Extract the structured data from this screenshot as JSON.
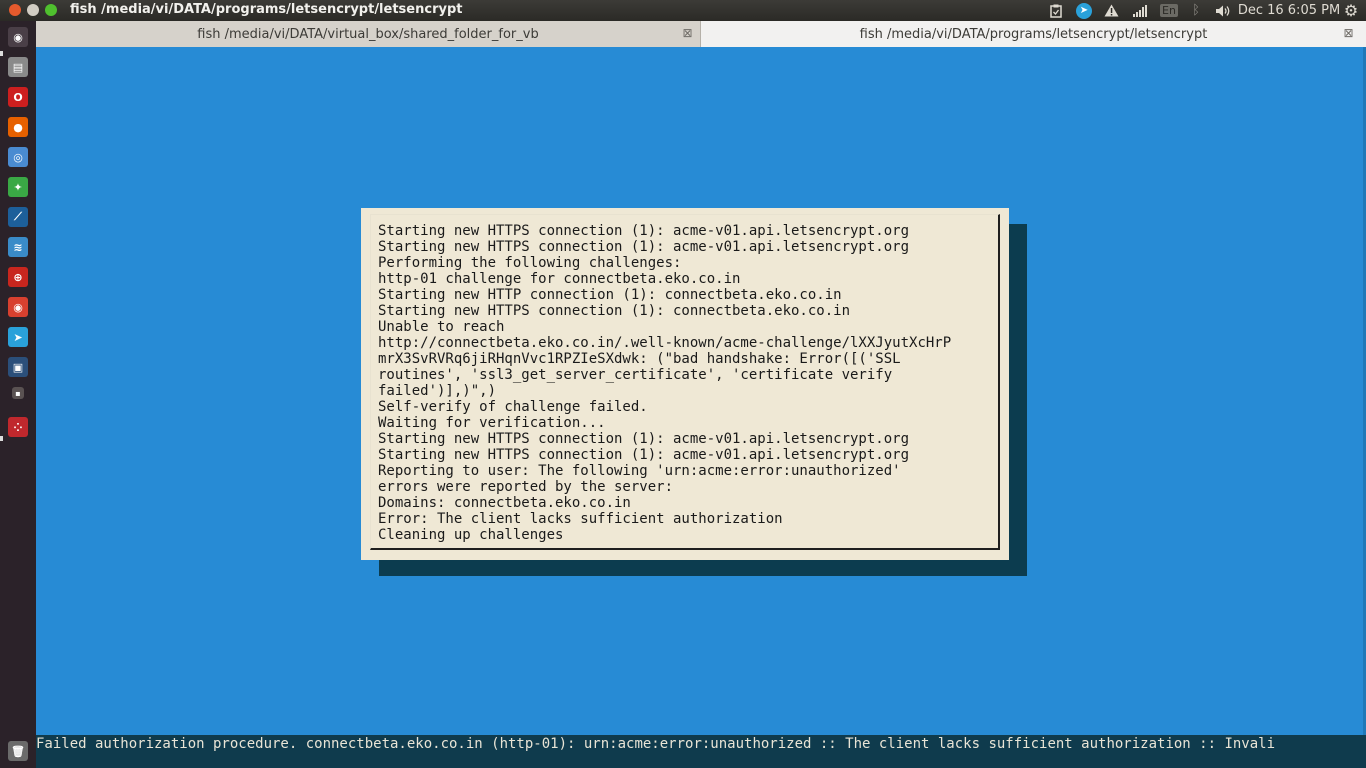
{
  "window": {
    "title": "fish  /media/vi/DATA/programs/letsencrypt/letsencrypt"
  },
  "tray": {
    "language": "En",
    "clock": "Dec 16  6:05 PM",
    "icons": [
      "clipboard-icon",
      "telegram-icon",
      "warning-icon",
      "network-signal-icon",
      "bluetooth-icon",
      "volume-icon",
      "gear-icon"
    ]
  },
  "launcher": {
    "items": [
      {
        "name": "dash-home",
        "color": "#4a3f47",
        "glyph": "◉"
      },
      {
        "name": "files",
        "color": "#8a8a8a",
        "glyph": "▤"
      },
      {
        "name": "opera",
        "color": "#cc1f1f",
        "glyph": "O"
      },
      {
        "name": "firefox",
        "color": "#e66000",
        "glyph": "●"
      },
      {
        "name": "chromium",
        "color": "#4a8bd1",
        "glyph": "◎"
      },
      {
        "name": "app-green",
        "color": "#3aa845",
        "glyph": "✦"
      },
      {
        "name": "app-wireshark",
        "color": "#1d5f9a",
        "glyph": "⟋"
      },
      {
        "name": "system-monitor",
        "color": "#3a8bc8",
        "glyph": "≋"
      },
      {
        "name": "ssl-vpn",
        "color": "#c8261e",
        "glyph": "⊕"
      },
      {
        "name": "chrome",
        "color": "#d8402f",
        "glyph": "◉"
      },
      {
        "name": "telegram",
        "color": "#2aa1da",
        "glyph": "➤"
      },
      {
        "name": "virtualbox-terminal",
        "color": "#2b4f7a",
        "glyph": "▣"
      },
      {
        "name": "small-app",
        "color": "#5a5252",
        "glyph": "▪"
      },
      {
        "name": "app-red-grid",
        "color": "#c0282d",
        "glyph": "⁘"
      },
      {
        "name": "trash",
        "color": "#6b6b6b",
        "glyph": "🗑"
      }
    ]
  },
  "tabs": [
    {
      "label": "fish  /media/vi/DATA/virtual_box/shared_folder_for_vb"
    },
    {
      "label": "fish  /media/vi/DATA/programs/letsencrypt/letsencrypt"
    }
  ],
  "dialog": {
    "lines": [
      "Starting new HTTPS connection (1): acme-v01.api.letsencrypt.org",
      "Starting new HTTPS connection (1): acme-v01.api.letsencrypt.org",
      "Performing the following challenges:",
      "http-01 challenge for connectbeta.eko.co.in",
      "Starting new HTTP connection (1): connectbeta.eko.co.in",
      "Starting new HTTPS connection (1): connectbeta.eko.co.in",
      "Unable to reach",
      "http://connectbeta.eko.co.in/.well-known/acme-challenge/lXXJyutXcHrP",
      "mrX3SvRVRq6jiRHqnVvc1RPZIeSXdwk: (\"bad handshake: Error([('SSL",
      "routines', 'ssl3_get_server_certificate', 'certificate verify",
      "failed')],)\",)",
      "Self-verify of challenge failed.",
      "Waiting for verification...",
      "Starting new HTTPS connection (1): acme-v01.api.letsencrypt.org",
      "Starting new HTTPS connection (1): acme-v01.api.letsencrypt.org",
      "Reporting to user: The following 'urn:acme:error:unauthorized'",
      "errors were reported by the server:",
      "Domains: connectbeta.eko.co.in",
      "Error: The client lacks sufficient authorization",
      "Cleaning up challenges"
    ]
  },
  "status": {
    "text": "Failed authorization procedure. connectbeta.eko.co.in (http-01): urn:acme:error:unauthorized :: The client lacks sufficient authorization :: Invali"
  }
}
